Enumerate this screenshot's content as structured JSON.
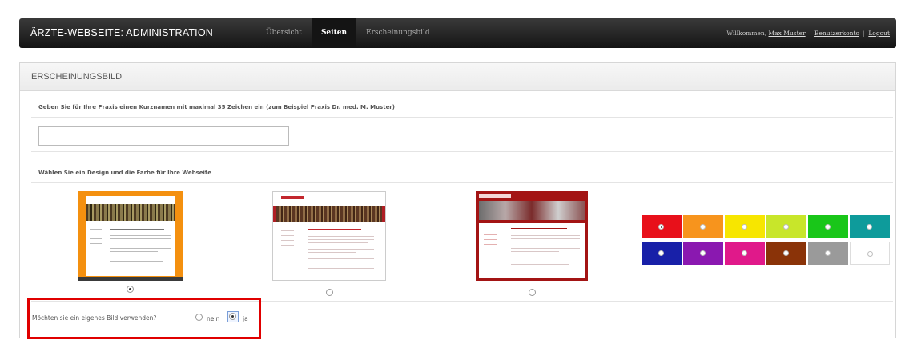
{
  "header": {
    "title": "ÄRZTE-WEBSEITE: ADMINISTRATION",
    "nav": [
      {
        "label": "Übersicht",
        "active": false
      },
      {
        "label": "Seiten",
        "active": true
      },
      {
        "label": "Erscheinungsbild",
        "active": false
      }
    ],
    "welcome": "Willkommen,",
    "user_name": "Max Muster",
    "account_link": "Benutzerkonto",
    "logout_link": "Logout",
    "separator": "|"
  },
  "panel": {
    "title": "ERSCHEINUNGSBILD",
    "name_prompt": "Geben Sie für Ihre Praxis einen Kurznamen mit maximal 35 Zeichen ein (zum Beispiel Praxis Dr. med. M. Muster)",
    "name_value": "",
    "design_prompt": "Wählen Sie ein Design und die Farbe für Ihre Webseite",
    "designs": [
      {
        "name": "design-orange",
        "selected": true
      },
      {
        "name": "design-white-red",
        "selected": false
      },
      {
        "name": "design-dark-red",
        "selected": false
      }
    ],
    "colors": [
      {
        "hex": "#e8101a",
        "selected": true
      },
      {
        "hex": "#f7941d",
        "selected": false
      },
      {
        "hex": "#f7e600",
        "selected": false
      },
      {
        "hex": "#c8e62a",
        "selected": false
      },
      {
        "hex": "#19c619",
        "selected": false
      },
      {
        "hex": "#0e9b9b",
        "selected": false
      },
      {
        "hex": "#1820a8",
        "selected": false
      },
      {
        "hex": "#8a18b0",
        "selected": false
      },
      {
        "hex": "#e0198a",
        "selected": false
      },
      {
        "hex": "#8a3308",
        "selected": false
      },
      {
        "hex": "#9a9a9a",
        "selected": false
      },
      {
        "hex": "#ffffff",
        "selected": false
      }
    ],
    "own_image_question": "Möchten sie ein eigenes Bild verwenden?",
    "option_no": "nein",
    "option_yes": "ja",
    "own_image_selected": "ja"
  },
  "accent": "#e00000"
}
